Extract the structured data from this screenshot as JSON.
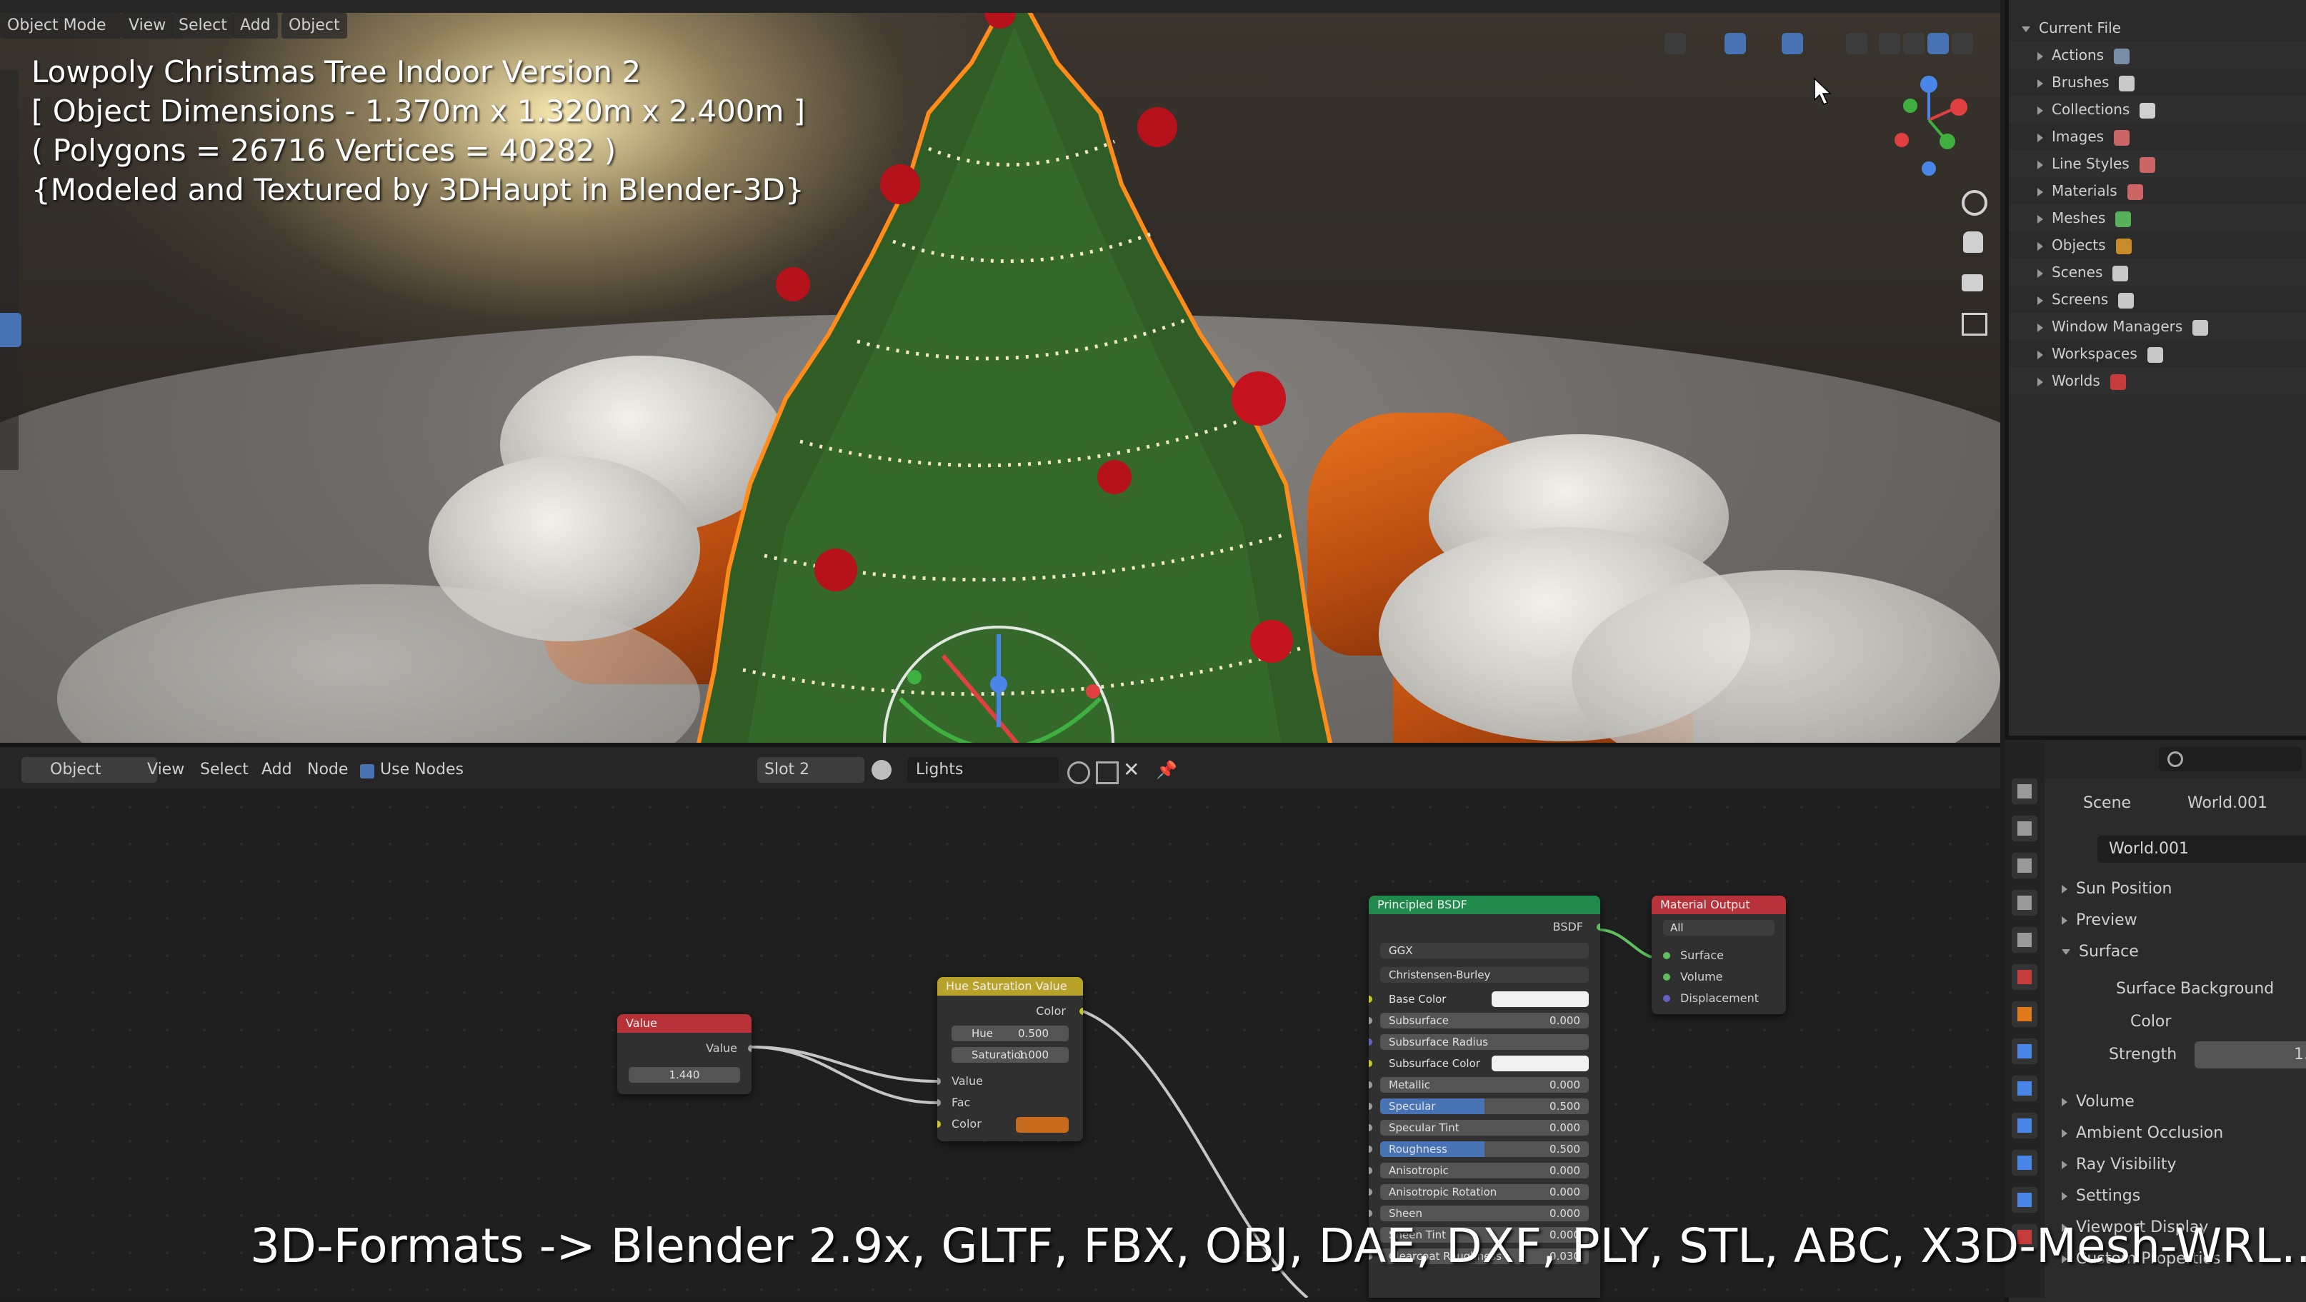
{
  "topbar": {
    "editor_mode": "Object Mode",
    "menus": [
      "View",
      "Select",
      "Add",
      "Object"
    ]
  },
  "viewport_overlay": {
    "line1": "Lowpoly Christmas Tree Indoor Version 2",
    "line2": "[ Object Dimensions -  1.370m x 1.320m x 2.400m ]",
    "line3": "( Polygons = 26716  Vertices = 40282 )",
    "line4": "{Modeled and Textured by 3DHaupt in Blender-3D}"
  },
  "outliner": {
    "root": "Current File",
    "items": [
      {
        "label": "Actions"
      },
      {
        "label": "Brushes"
      },
      {
        "label": "Collections"
      },
      {
        "label": "Images"
      },
      {
        "label": "Line Styles"
      },
      {
        "label": "Materials"
      },
      {
        "label": "Meshes"
      },
      {
        "label": "Objects"
      },
      {
        "label": "Scenes"
      },
      {
        "label": "Screens"
      },
      {
        "label": "Window Managers"
      },
      {
        "label": "Workspaces"
      },
      {
        "label": "Worlds"
      }
    ]
  },
  "node_header": {
    "mode": "Object",
    "menus": [
      "View",
      "Select",
      "Add",
      "Node"
    ],
    "use_nodes_label": "Use Nodes",
    "slot": "Slot 2",
    "material": "Lights"
  },
  "nodes": {
    "value": {
      "title": "Value",
      "output": "Value",
      "field": "1.440"
    },
    "hsv": {
      "title": "Hue Saturation Value",
      "output": "Color",
      "hue_label": "Hue",
      "hue": "0.500",
      "sat_label": "Saturation",
      "sat": "1.000",
      "in_value": "Value",
      "in_fac": "Fac",
      "in_color": "Color"
    },
    "bsdf": {
      "title": "Principled BSDF",
      "output": "BSDF",
      "dist": "GGX",
      "sss_method": "Christensen-Burley",
      "rows": [
        {
          "label": "Base Color",
          "value": ""
        },
        {
          "label": "Subsurface",
          "value": "0.000"
        },
        {
          "label": "Subsurface Radius",
          "value": ""
        },
        {
          "label": "Subsurface Color",
          "value": ""
        },
        {
          "label": "Metallic",
          "value": "0.000"
        },
        {
          "label": "Specular",
          "value": "0.500"
        },
        {
          "label": "Specular Tint",
          "value": "0.000"
        },
        {
          "label": "Roughness",
          "value": "0.500"
        },
        {
          "label": "Anisotropic",
          "value": "0.000"
        },
        {
          "label": "Anisotropic Rotation",
          "value": "0.000"
        },
        {
          "label": "Sheen",
          "value": "0.000"
        },
        {
          "label": "Sheen Tint",
          "value": "0.000"
        },
        {
          "label": "Clearcoat Roughness",
          "value": "0.030"
        }
      ]
    },
    "output": {
      "title": "Material Output",
      "target": "All",
      "surface": "Surface",
      "volume": "Volume",
      "displacement": "Displacement"
    }
  },
  "properties": {
    "scene": "Scene",
    "world": "World.001",
    "world_field": "World.001",
    "panels": [
      "Sun Position",
      "Preview",
      "Surface"
    ],
    "surface_label": "Surface",
    "surface_value": "Background",
    "color_label": "Color",
    "strength_label": "Strength",
    "strength_value": "1.",
    "subpanels": [
      "Volume",
      "Ambient Occlusion",
      "Ray Visibility",
      "Settings",
      "Viewport Display",
      "Custom Properties"
    ]
  },
  "caption": "3D-Formats -> Blender 2.9x, GLTF, FBX, OBJ, DAE, DXF, PLY, STL, ABC, X3D-Mesh-WRL..",
  "colors": {
    "accent": "#4772b3",
    "outline": "#ff8c1a",
    "bsdf_header": "#1f8a4c",
    "value_header": "#b8323a",
    "hsv_header": "#b8a22a"
  }
}
